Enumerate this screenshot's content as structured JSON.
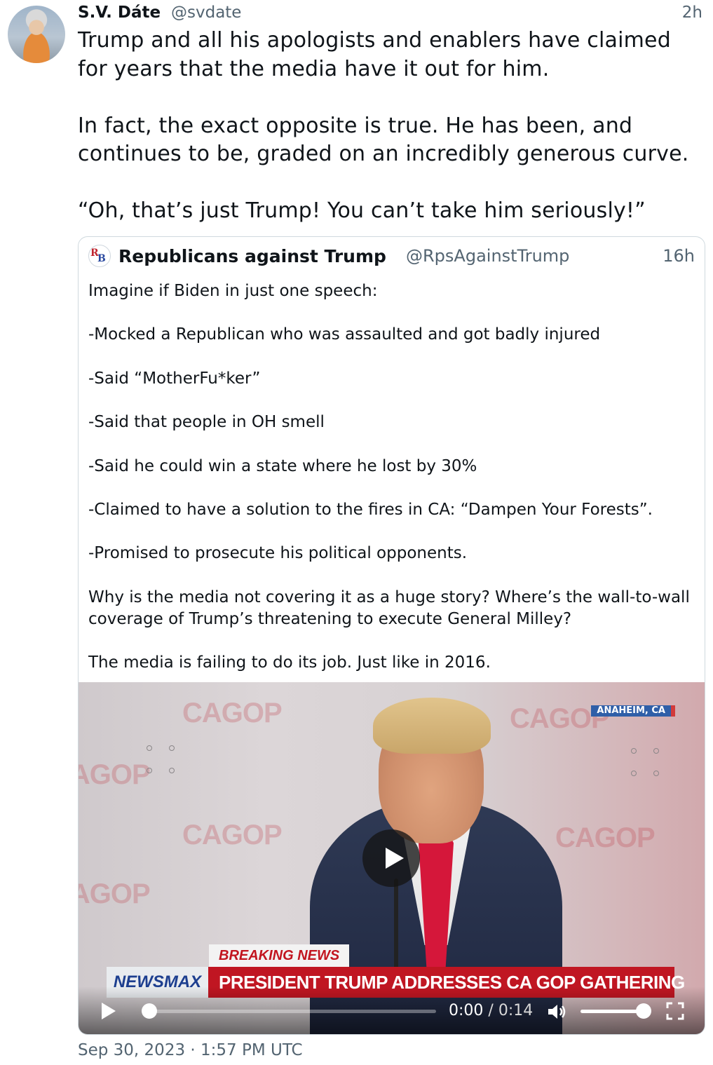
{
  "tweet": {
    "author_name": "S.V. Dáte",
    "author_handle": "@svdate",
    "time": "2h",
    "text": "Trump and all his apologists and enablers have claimed for years that the media have it out for him.\n\nIn fact, the exact opposite is true. He has been, and continues to be, graded on an incredibly generous curve.\n\n“Oh, that’s just Trump! You can’t take him seriously!”",
    "timestamp": "Sep 30, 2023 · 1:57 PM UTC"
  },
  "quote": {
    "avatar_text": "RB",
    "author_name": "Republicans against Trump",
    "author_handle": "@RpsAgainstTrump",
    "time": "16h",
    "text": "Imagine if Biden in just one speech:\n\n-Mocked a Republican who was assaulted and got badly injured\n\n-Said “MotherFu*ker”\n\n-Said that people in OH smell\n\n-Said he could win a state where he lost by 30%\n\n-Claimed to have a solution to the fires in CA: “Dampen Your Forests”.\n\n-Promised to prosecute his political opponents.\n\nWhy is the media not covering it as a huge story? Where’s the wall-to-wall coverage of Trump’s threatening to execute General Milley?\n\nThe media is failing to do its job. Just like in 2016."
  },
  "video": {
    "location_tag": "ANAHEIM, CA",
    "backdrop_logo": "CAGOP",
    "breaking_label": "BREAKING NEWS",
    "network_brand": "NEWSMAX",
    "headline": "PRESIDENT TRUMP ADDRESSES CA GOP GATHERING",
    "current_time": "0:00",
    "separator": "/",
    "duration": "0:14",
    "progress_fraction": 0.0,
    "volume_fraction": 1.0
  },
  "colors": {
    "text_primary": "#0f1419",
    "text_secondary": "#536471",
    "border": "#cfd9de",
    "breaking_red": "#c01622"
  },
  "icons": {
    "play": "play-icon",
    "volume": "volume-icon",
    "fullscreen": "fullscreen-icon"
  }
}
